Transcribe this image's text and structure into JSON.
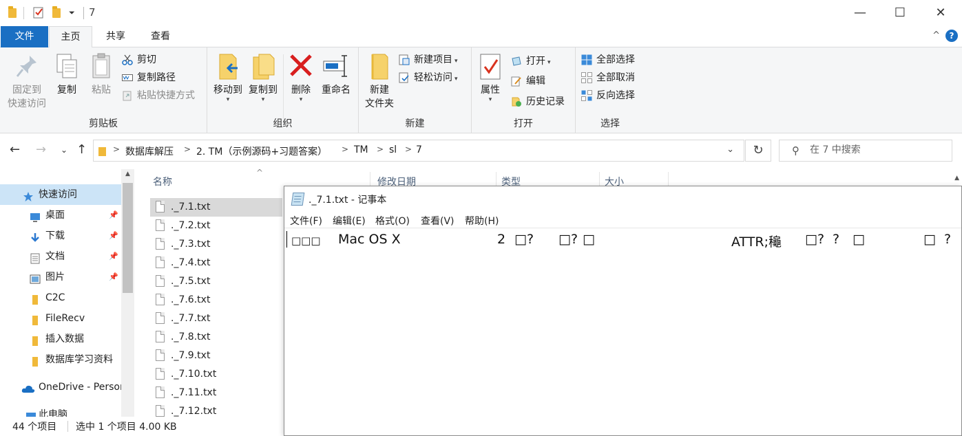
{
  "explorer": {
    "window_title": "7",
    "window_controls": {
      "minimize": "—",
      "maximize": "☐",
      "close": "✕"
    },
    "ribbon_tabs": [
      "文件",
      "主页",
      "共享",
      "查看"
    ],
    "ribbon_collapse": "^",
    "help": "?",
    "ribbon": {
      "clipboard": {
        "label": "剪贴板",
        "pin_line1": "固定到",
        "pin_line2": "快速访问",
        "copy": "复制",
        "paste": "粘贴",
        "cut": "剪切",
        "copy_path": "复制路径",
        "paste_shortcut": "粘贴快捷方式"
      },
      "organize": {
        "label": "组织",
        "move_to": "移动到",
        "copy_to": "复制到",
        "delete": "删除",
        "rename": "重命名"
      },
      "new": {
        "label": "新建",
        "new_folder_line1": "新建",
        "new_folder_line2": "文件夹",
        "new_item": "新建项目",
        "easy_access": "轻松访问"
      },
      "open": {
        "label": "打开",
        "properties": "属性",
        "open": "打开",
        "edit": "编辑",
        "history": "历史记录"
      },
      "select": {
        "label": "选择",
        "select_all": "全部选择",
        "select_none": "全部取消",
        "invert": "反向选择"
      }
    },
    "breadcrumbs": [
      "数据库解压",
      "2. TM（示例源码+习题答案）",
      "TM",
      "sl",
      "7"
    ],
    "search": {
      "placeholder": "在 7 中搜索"
    },
    "nav_items": [
      {
        "label": "快速访问",
        "icon": "star-icon",
        "pinned": false
      },
      {
        "label": "桌面",
        "icon": "desktop-icon",
        "pinned": true
      },
      {
        "label": "下载",
        "icon": "download-icon",
        "pinned": true
      },
      {
        "label": "文档",
        "icon": "document-icon",
        "pinned": true
      },
      {
        "label": "图片",
        "icon": "picture-icon",
        "pinned": true
      },
      {
        "label": "C2C",
        "icon": "folder-icon",
        "pinned": false
      },
      {
        "label": "FileRecv",
        "icon": "folder-icon",
        "pinned": false
      },
      {
        "label": "插入数据",
        "icon": "folder-icon",
        "pinned": false
      },
      {
        "label": "数据库学习资料",
        "icon": "folder-icon",
        "pinned": false
      },
      {
        "label": "OneDrive - Personal",
        "icon": "cloud-icon",
        "pinned": false
      },
      {
        "label": "此电脑",
        "icon": "computer-icon",
        "pinned": false
      }
    ],
    "columns": [
      "名称",
      "修改日期",
      "类型",
      "大小"
    ],
    "files": [
      "._7.1.txt",
      "._7.2.txt",
      "._7.3.txt",
      "._7.4.txt",
      "._7.5.txt",
      "._7.6.txt",
      "._7.7.txt",
      "._7.8.txt",
      "._7.9.txt",
      "._7.10.txt",
      "._7.11.txt",
      "._7.12.txt"
    ],
    "selected_file_index": 0,
    "status": {
      "item_count": "44 个项目",
      "selection": "选中 1 个项目  4.00 KB"
    }
  },
  "notepad": {
    "title": "._7.1.txt - 记事本",
    "menu": [
      "文件(F)",
      "编辑(E)",
      "格式(O)",
      "查看(V)",
      "帮助(H)"
    ],
    "content_chunks": [
      "□□□",
      "Mac OS X",
      "2",
      "□?",
      "□?",
      "□",
      "ATTR;龝",
      "□?",
      "?",
      "□",
      "□",
      "?"
    ]
  },
  "colors": {
    "accent_blue": "#1a6fc3",
    "selection_gray": "#d9d9d9",
    "quick_access_highlight": "#cce4f7",
    "ribbon_bg": "#f5f6f7",
    "header_text": "#4c607a"
  }
}
